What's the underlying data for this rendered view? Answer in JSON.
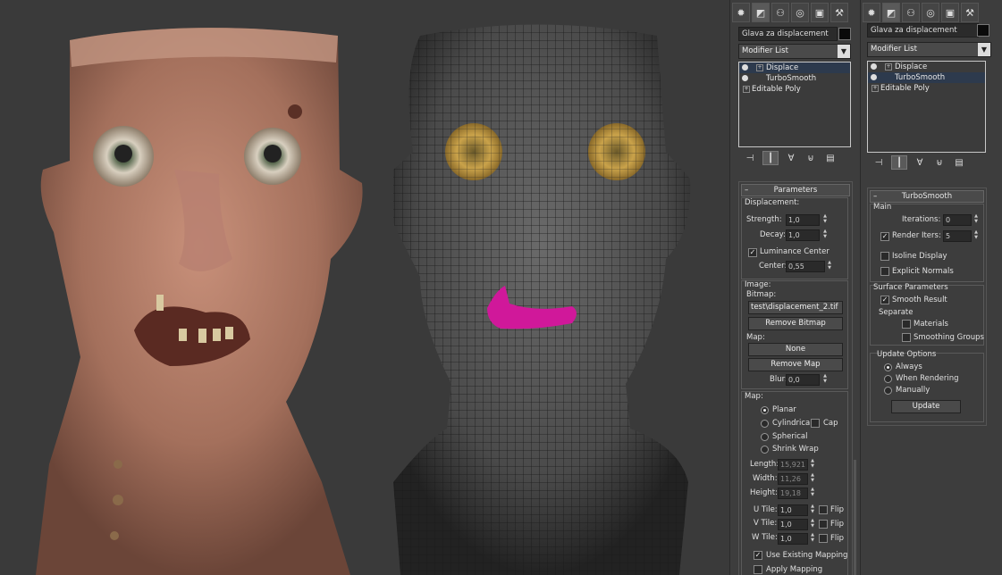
{
  "panel1": {
    "object_name": "Glava za displacement",
    "modifier_list": "Modifier List",
    "stack": [
      {
        "label": "Displace",
        "selected": true
      },
      {
        "label": "TurboSmooth",
        "selected": false
      },
      {
        "label": "Editable Poly",
        "selected": false
      }
    ],
    "rollout_title": "Parameters",
    "displacement_label": "Displacement:",
    "strength_label": "Strength:",
    "strength_value": "1,0",
    "decay_label": "Decay:",
    "decay_value": "1,0",
    "luminance_center_label": "Luminance Center",
    "center_label": "Center:",
    "center_value": "0,55",
    "image_label": "Image:",
    "bitmap_label": "Bitmap:",
    "bitmap_value": "test\\displacement_2.tif",
    "remove_bitmap_label": "Remove Bitmap",
    "map_label": "Map:",
    "none_label": "None",
    "remove_map_label": "Remove Map",
    "blur_label": "Blur:",
    "blur_value": "0,0",
    "map_group_label": "Map:",
    "planar_label": "Planar",
    "cylindrical_label": "Cylindrical",
    "cap_label": "Cap",
    "spherical_label": "Spherical",
    "shrink_wrap_label": "Shrink Wrap",
    "length_label": "Length:",
    "length_value": "15,921",
    "width_label": "Width:",
    "width_value": "11,26",
    "height_label": "Height:",
    "height_value": "19,18",
    "u_tile_label": "U Tile:",
    "u_tile_value": "1,0",
    "v_tile_label": "V Tile:",
    "v_tile_value": "1,0",
    "w_tile_label": "W Tile:",
    "w_tile_value": "1,0",
    "flip_label": "Flip",
    "use_existing_mapping_label": "Use Existing Mapping",
    "apply_mapping_label": "Apply Mapping"
  },
  "panel2": {
    "object_name": "Glava za displacement",
    "modifier_list": "Modifier List",
    "stack": [
      {
        "label": "Displace",
        "selected": false
      },
      {
        "label": "TurboSmooth",
        "selected": true
      },
      {
        "label": "Editable Poly",
        "selected": false
      }
    ],
    "rollout_title": "TurboSmooth",
    "main_label": "Main",
    "iterations_label": "Iterations:",
    "iterations_value": "0",
    "render_iters_label": "Render Iters:",
    "render_iters_value": "5",
    "isoline_label": "Isoline Display",
    "explicit_normals_label": "Explicit Normals",
    "surface_params_label": "Surface Parameters",
    "smooth_result_label": "Smooth Result",
    "separate_label": "Separate",
    "materials_label": "Materials",
    "smoothing_groups_label": "Smoothing Groups",
    "update_options_label": "Update Options",
    "always_label": "Always",
    "when_rendering_label": "When Rendering",
    "manually_label": "Manually",
    "update_button_label": "Update"
  },
  "icons": {
    "create_tab": "sun-icon",
    "modify_tab": "modify-icon",
    "hierarchy_tab": "hierarchy-icon",
    "motion_tab": "motion-icon",
    "display_tab": "display-icon",
    "utilities_tab": "hammer-icon"
  }
}
